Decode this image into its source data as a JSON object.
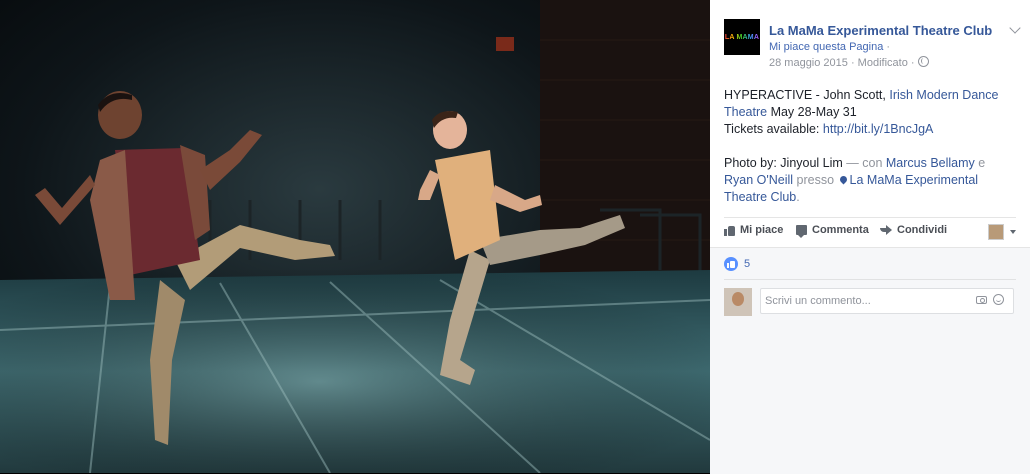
{
  "photo": {
    "alt_subject": "two-dancers-on-stage"
  },
  "post": {
    "page_name": "La MaMa Experimental Theatre Club",
    "avatar_text": "LA MAMA",
    "like_page": "Mi piace questa Pagina",
    "like_page_dot": " ·",
    "date": "28 maggio 2015",
    "edited": " · Modificato ·",
    "body": {
      "line1_a": "HYPERACTIVE - John Scott, ",
      "line1_link": "Irish Modern Dance Theatre",
      "line1_b": " May 28-May 31",
      "tickets_label": "Tickets available: ",
      "tickets_link": "http://bit.ly/1BncJgA",
      "photo_by": "Photo by: Jinyoul Lim",
      "with": " — con ",
      "person1": "Marcus Bellamy",
      "and": " e ",
      "person2": "Ryan O'Neill",
      "at": " presso ",
      "place": "La MaMa Experimental Theatre Club",
      "end": "."
    }
  },
  "actions": {
    "like": "Mi piace",
    "comment": "Commenta",
    "share": "Condividi"
  },
  "reactions": {
    "count": "5"
  },
  "comment_box": {
    "placeholder": "Scrivi un commento..."
  },
  "colors": {
    "link": "#365899",
    "accent": "#4267b2",
    "panel_bg": "#ffffff",
    "footer_bg": "#f6f7f9"
  },
  "icons": [
    "chevron-down-icon",
    "globe-icon",
    "like-icon",
    "comment-icon",
    "share-icon",
    "location-pin-icon",
    "like-reaction-icon",
    "camera-icon",
    "emoji-icon"
  ]
}
